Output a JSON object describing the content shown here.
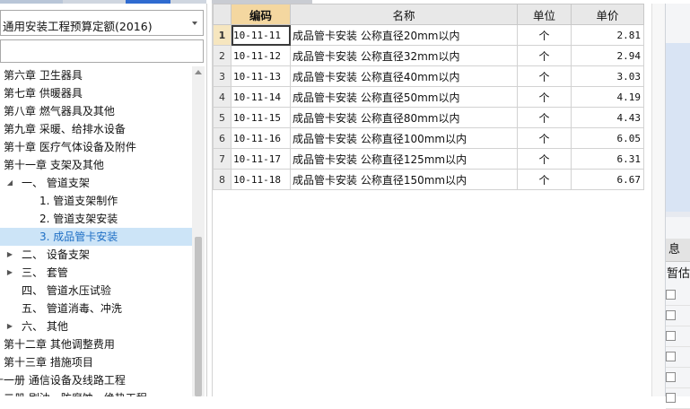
{
  "left": {
    "combo_value": "通用安装工程预算定额(2016)",
    "search_value": "",
    "tree": [
      {
        "label": "第六章 卫生器具",
        "indent": 0,
        "caret": ""
      },
      {
        "label": "第七章 供暖器具",
        "indent": 0,
        "caret": ""
      },
      {
        "label": "第八章 燃气器具及其他",
        "indent": 0,
        "caret": ""
      },
      {
        "label": "第九章 采暖、给排水设备",
        "indent": 0,
        "caret": ""
      },
      {
        "label": "第十章 医疗气体设备及附件",
        "indent": 0,
        "caret": ""
      },
      {
        "label": "第十一章 支架及其他",
        "indent": 0,
        "caret": ""
      },
      {
        "label": "一、 管道支架",
        "indent": 1,
        "caret": "expanded"
      },
      {
        "label": "1. 管道支架制作",
        "indent": 2,
        "caret": ""
      },
      {
        "label": "2. 管道支架安装",
        "indent": 2,
        "caret": ""
      },
      {
        "label": "3. 成品管卡安装",
        "indent": 2,
        "caret": "",
        "selected": true
      },
      {
        "label": "二、 设备支架",
        "indent": 1,
        "caret": "collapsed"
      },
      {
        "label": "三、 套管",
        "indent": 1,
        "caret": "collapsed"
      },
      {
        "label": "四、 管道水压试验",
        "indent": 1,
        "caret": ""
      },
      {
        "label": "五、 管道消毒、冲洗",
        "indent": 1,
        "caret": ""
      },
      {
        "label": "六、 其他",
        "indent": 1,
        "caret": "collapsed"
      },
      {
        "label": "第十二章 其他调整费用",
        "indent": 0,
        "caret": ""
      },
      {
        "label": "第十三章 措施项目",
        "indent": 0,
        "caret": ""
      },
      {
        "label": "十一册 通信设备及线路工程",
        "indent": -1,
        "caret": ""
      },
      {
        "label": "十二册 刷油、防腐蚀、绝热工程",
        "indent": -1,
        "caret": ""
      }
    ]
  },
  "grid": {
    "headers": {
      "code": "编码",
      "name": "名称",
      "unit": "单位",
      "price": "单价"
    },
    "rows": [
      {
        "idx": "1",
        "code": "10-11-11",
        "name": "成品管卡安装 公称直径20mm以内",
        "unit": "个",
        "price": "2.81"
      },
      {
        "idx": "2",
        "code": "10-11-12",
        "name": "成品管卡安装 公称直径32mm以内",
        "unit": "个",
        "price": "2.94"
      },
      {
        "idx": "3",
        "code": "10-11-13",
        "name": "成品管卡安装 公称直径40mm以内",
        "unit": "个",
        "price": "3.03"
      },
      {
        "idx": "4",
        "code": "10-11-14",
        "name": "成品管卡安装 公称直径50mm以内",
        "unit": "个",
        "price": "4.19"
      },
      {
        "idx": "5",
        "code": "10-11-15",
        "name": "成品管卡安装 公称直径80mm以内",
        "unit": "个",
        "price": "4.43"
      },
      {
        "idx": "6",
        "code": "10-11-16",
        "name": "成品管卡安装 公称直径100mm以内",
        "unit": "个",
        "price": "6.05"
      },
      {
        "idx": "7",
        "code": "10-11-17",
        "name": "成品管卡安装 公称直径125mm以内",
        "unit": "个",
        "price": "6.31"
      },
      {
        "idx": "8",
        "code": "10-11-18",
        "name": "成品管卡安装 公称直径150mm以内",
        "unit": "个",
        "price": "6.67"
      }
    ]
  },
  "right": {
    "tab_label": "息",
    "col_header": "暂估"
  }
}
